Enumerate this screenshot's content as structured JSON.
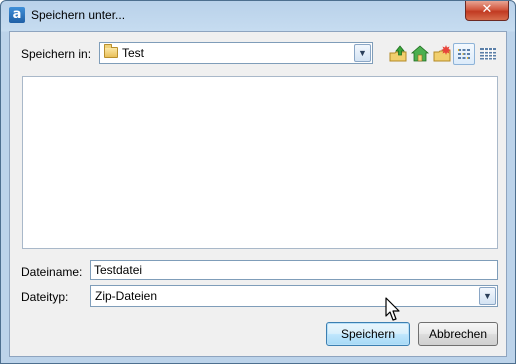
{
  "window": {
    "title": "Speichern unter...",
    "app_icon_letter": "a",
    "close_glyph": "✕"
  },
  "location": {
    "label": "Speichern in:",
    "folder_icon": "folder-icon",
    "value": "Test"
  },
  "toolbar": {
    "icons": [
      "folder-up-icon",
      "home-icon",
      "new-folder-icon",
      "list-view-icon",
      "details-view-icon"
    ],
    "active_view": "list-view-icon"
  },
  "filename": {
    "label": "Dateiname:",
    "value": "Testdatei"
  },
  "filetype": {
    "label": "Dateityp:",
    "value": "Zip-Dateien"
  },
  "buttons": {
    "save": "Speichern",
    "cancel": "Abbrechen"
  },
  "colors": {
    "frame": "#bcd3ea",
    "client": "#f0f0f0",
    "default_button": "#bee6fd",
    "close_button": "#c13a22"
  }
}
